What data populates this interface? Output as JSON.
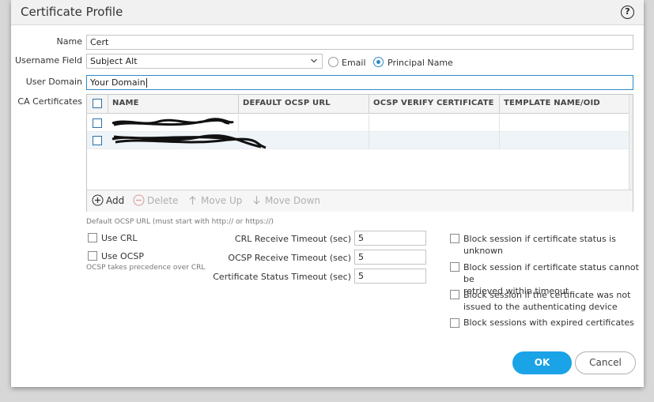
{
  "dialog": {
    "title": "Certificate Profile",
    "help_glyph": "?"
  },
  "form": {
    "name_label": "Name",
    "name_value": "Cert",
    "username_field_label": "Username Field",
    "username_field_value": "Subject Alt",
    "radio_email_label": "Email",
    "radio_principal_label": "Principal Name",
    "radio_selected": "Principal Name",
    "user_domain_label": "User Domain",
    "user_domain_value": "Your Domain",
    "ca_certificates_label": "CA Certificates"
  },
  "table": {
    "columns": [
      "NAME",
      "DEFAULT OCSP URL",
      "OCSP VERIFY CERTIFICATE",
      "TEMPLATE NAME/OID"
    ],
    "row_count": 2
  },
  "toolbar": {
    "add": "Add",
    "delete": "Delete",
    "move_up": "Move Up",
    "move_down": "Move Down"
  },
  "hints": {
    "ocsp_url": "Default OCSP URL (must start with http:// or https://)",
    "ocsp_precedence": "OCSP takes precedence over CRL"
  },
  "options": {
    "use_crl": "Use CRL",
    "use_ocsp": "Use OCSP"
  },
  "timeouts": {
    "crl_label": "CRL Receive Timeout (sec)",
    "crl_value": "5",
    "ocsp_label": "OCSP Receive Timeout (sec)",
    "ocsp_value": "5",
    "status_label": "Certificate Status Timeout (sec)",
    "status_value": "5"
  },
  "block": {
    "unknown_l1": "Block session if certificate status is",
    "unknown_l2": "unknown",
    "timeout_l1": "Block session if certificate status cannot be",
    "timeout_l2": "retrieved within timeout",
    "issued_l1": "Block session if the certificate was not",
    "issued_l2": "issued to the authenticating device",
    "expired": "Block sessions with expired certificates"
  },
  "buttons": {
    "ok": "OK",
    "cancel": "Cancel"
  },
  "colors": {
    "accent": "#1aa3e6",
    "focus": "#2d89c8"
  }
}
